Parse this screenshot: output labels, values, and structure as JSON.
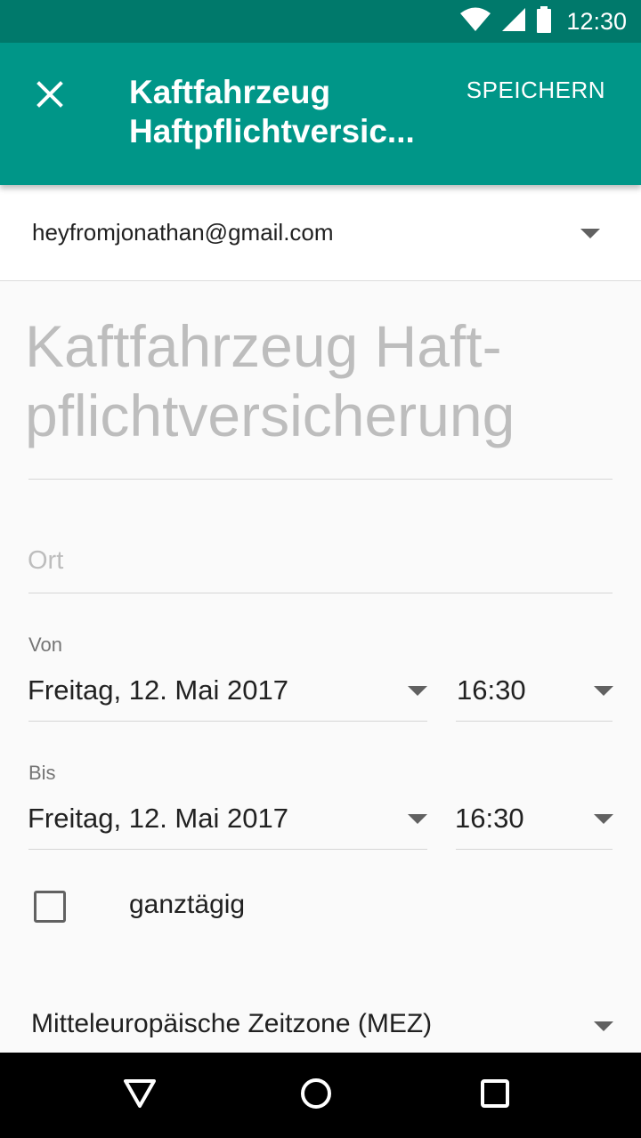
{
  "status_bar": {
    "time": "12:30",
    "icons": [
      "wifi-icon",
      "cell-signal-icon",
      "battery-icon"
    ]
  },
  "app_bar": {
    "close_icon": "close-icon",
    "title_line1": "Kaftfahrzeug",
    "title_line2": "Haftpflichtversic...",
    "save_label": "SPEICHERN"
  },
  "account": {
    "email": "heyfromjonathan@gmail.com"
  },
  "event": {
    "title_line1": "Kaftfahrzeug Haft-",
    "title_line2": "pflichtversicherung",
    "location_placeholder": "Ort"
  },
  "from": {
    "label": "Von",
    "date": "Freitag, 12. Mai 2017",
    "time": "16:30"
  },
  "to": {
    "label": "Bis",
    "date": "Freitag, 12. Mai 2017",
    "time": "16:30"
  },
  "all_day": {
    "label": "ganztägig",
    "checked": false
  },
  "timezone": {
    "value": "Mitteleuropäische Zeitzone (MEZ)"
  },
  "nav_bar": {
    "icons": [
      "back-icon",
      "home-icon",
      "recents-icon"
    ]
  },
  "colors": {
    "primary": "#009688",
    "primary_dark": "#00796b"
  }
}
